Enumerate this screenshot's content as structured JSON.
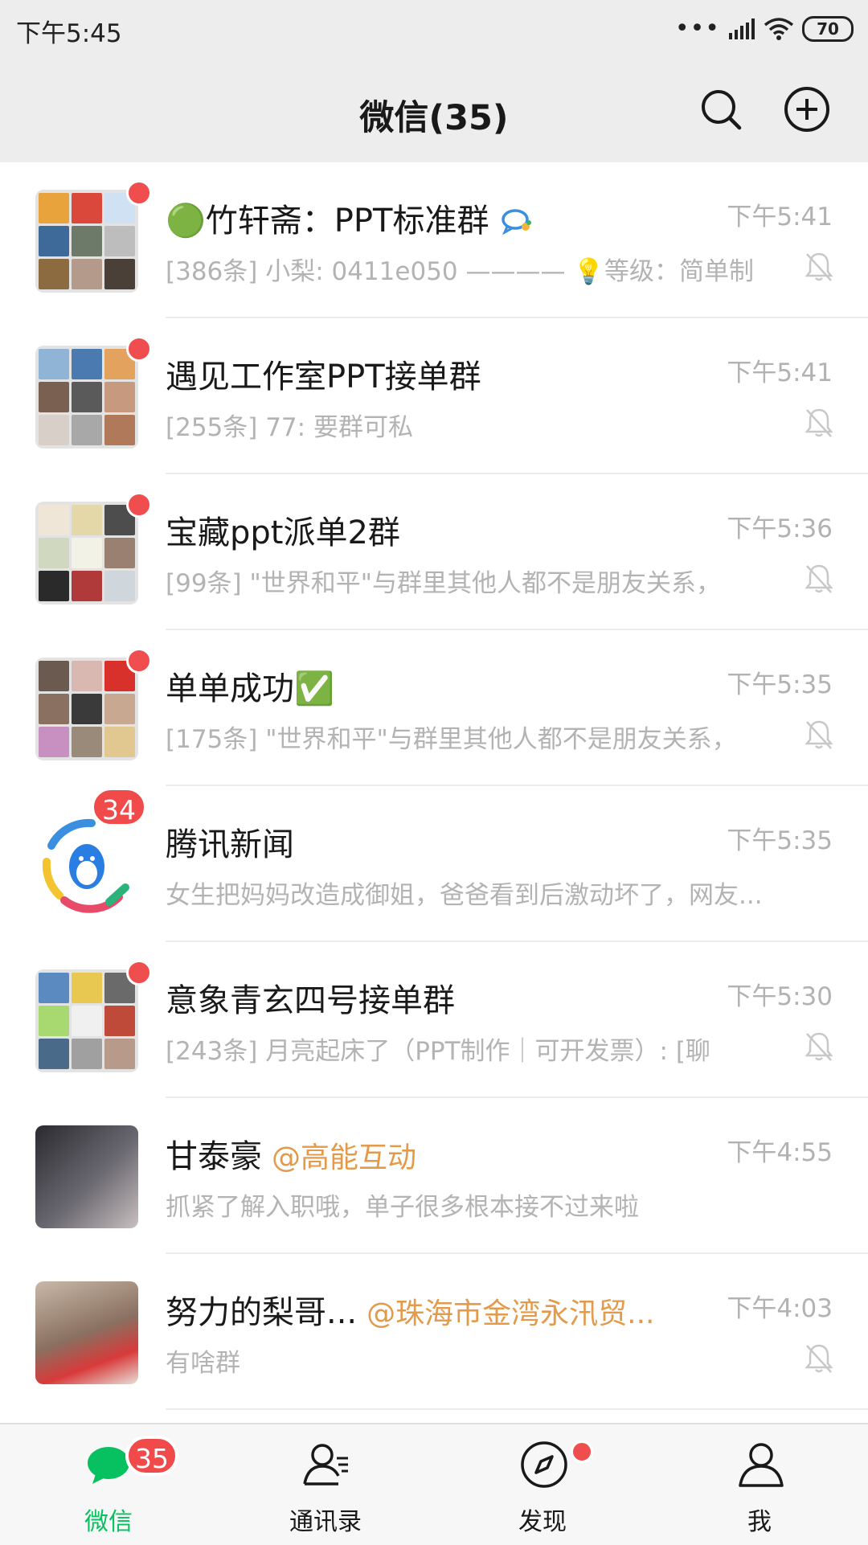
{
  "status_bar": {
    "time": "下午5:45",
    "battery": "70"
  },
  "header": {
    "title": "微信(35)"
  },
  "colors": {
    "accent_green": "#07c160",
    "badge_red": "#f04a4a",
    "mention_orange": "#e39a4a"
  },
  "chats": [
    {
      "name": "🟢竹轩斋：PPT标准群",
      "time": "下午5:41",
      "preview": "[386条] 小梨: 0411e050 ———— 💡等级：简单制",
      "muted": true,
      "unread": "dot"
    },
    {
      "name": "遇见工作室PPT接单群",
      "time": "下午5:41",
      "preview": "[255条] 77: 要群可私",
      "muted": true,
      "unread": "dot"
    },
    {
      "name": "宝藏ppt派单2群",
      "time": "下午5:36",
      "preview": "[99条] \"世界和平\"与群里其他人都不是朋友关系，",
      "muted": true,
      "unread": "dot"
    },
    {
      "name": "单单成功✅",
      "time": "下午5:35",
      "preview": "[175条] \"世界和平\"与群里其他人都不是朋友关系，",
      "muted": true,
      "unread": "dot"
    },
    {
      "name": "腾讯新闻",
      "time": "下午5:35",
      "preview": "女生把妈妈改造成御姐，爸爸看到后激动坏了，网友...",
      "muted": false,
      "unread_count": "34"
    },
    {
      "name": "意象青玄四号接单群",
      "time": "下午5:30",
      "preview": "[243条] 月亮起床了（PPT制作｜可开发票）: [聊",
      "muted": true,
      "unread": "dot"
    },
    {
      "name": "甘泰豪",
      "mention": "@高能互动",
      "time": "下午4:55",
      "preview": "抓紧了解入职哦，单子很多根本接不过来啦",
      "muted": false
    },
    {
      "name": "努力的梨哥...",
      "mention": "@珠海市金湾永汛贸...",
      "time": "下午4:03",
      "preview": "有啥群",
      "muted": true
    }
  ],
  "tabs": [
    {
      "label": "微信",
      "icon": "chat-bubble-icon",
      "badge": "35",
      "active": true
    },
    {
      "label": "通讯录",
      "icon": "contacts-icon"
    },
    {
      "label": "发现",
      "icon": "compass-icon",
      "dot": true
    },
    {
      "label": "我",
      "icon": "person-icon"
    }
  ]
}
